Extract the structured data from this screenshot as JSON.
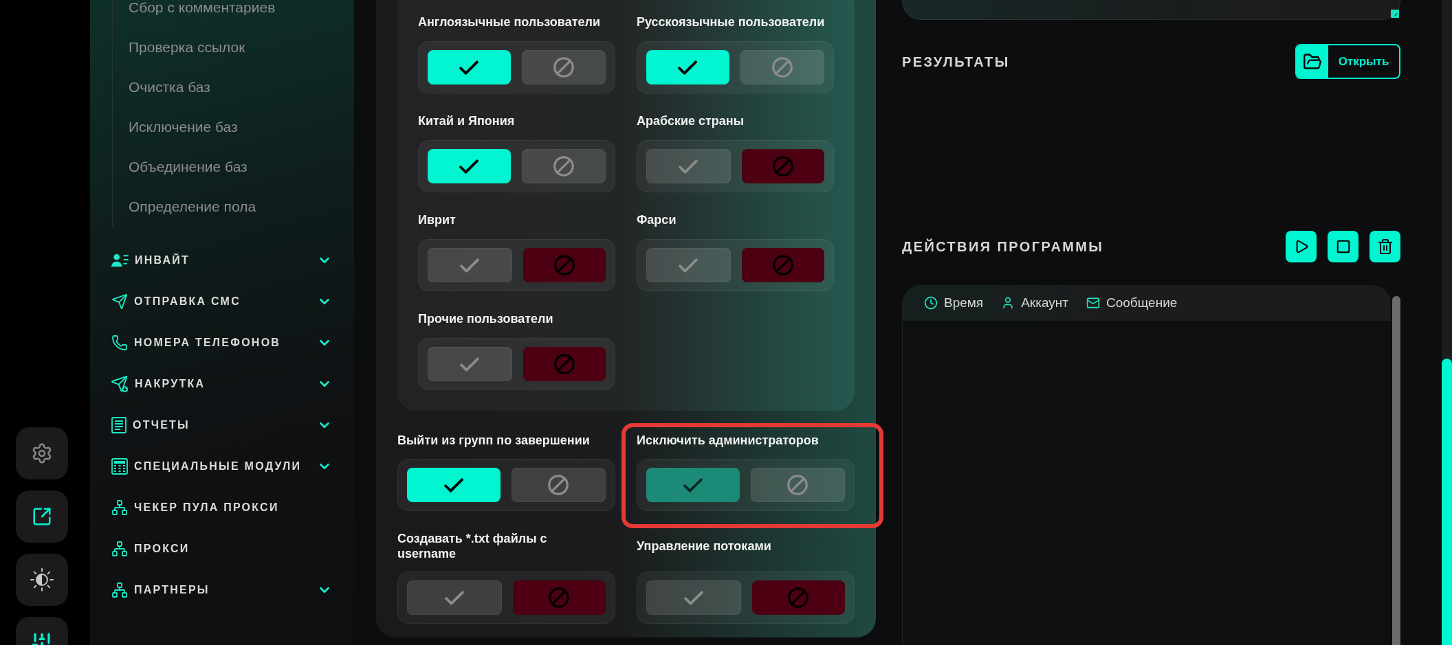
{
  "sidebar": {
    "submenu_items": [
      "Сбор с комментариев",
      "Проверка ссылок",
      "Очистка баз",
      "Исключение баз",
      "Объединение баз",
      "Определение пола"
    ],
    "sections": [
      {
        "label": "ИНВАЙТ",
        "kind": "group"
      },
      {
        "label": "ОТПРАВКА СМС",
        "kind": "group"
      },
      {
        "label": "НОМЕРА ТЕЛЕФОНОВ",
        "kind": "group"
      },
      {
        "label": "НАКРУТКА",
        "kind": "group"
      },
      {
        "label": "ОТЧЕТЫ",
        "kind": "group"
      },
      {
        "label": "СПЕЦИАЛЬНЫЕ МОДУЛИ",
        "kind": "group"
      },
      {
        "label": "ЧЕКЕР ПУЛА ПРОКСИ",
        "kind": "link"
      },
      {
        "label": "ПРОКСИ",
        "kind": "link"
      },
      {
        "label": "ПАРТНЕРЫ",
        "kind": "group"
      }
    ]
  },
  "audience_filters": [
    {
      "label": "Англоязычные пользователи",
      "on": true
    },
    {
      "label": "Русскоязычные пользователи",
      "on": true
    },
    {
      "label": "Китай и Япония",
      "on": true
    },
    {
      "label": "Арабские страны",
      "on": false
    },
    {
      "label": "Иврит",
      "on": false
    },
    {
      "label": "Фарси",
      "on": false
    },
    {
      "label": "Прочие пользователи",
      "on": false
    }
  ],
  "options": [
    {
      "label": "Выйти из групп по завершении",
      "on": true,
      "disabled": false,
      "highlighted": false
    },
    {
      "label": "Исключить администраторов",
      "on": true,
      "disabled": true,
      "highlighted": true
    },
    {
      "label": "Создавать *.txt файлы с username",
      "on": false,
      "disabled": false,
      "highlighted": false
    },
    {
      "label": "Управление потоками",
      "on": false,
      "disabled": false,
      "highlighted": false
    }
  ],
  "results": {
    "title": "РЕЗУЛЬТАТЫ",
    "open_button": "Открыть"
  },
  "program_actions": {
    "title": "ДЕЙСТВИЯ ПРОГРАММЫ",
    "log_columns": [
      "Время",
      "Аккаунт",
      "Сообщение"
    ]
  }
}
